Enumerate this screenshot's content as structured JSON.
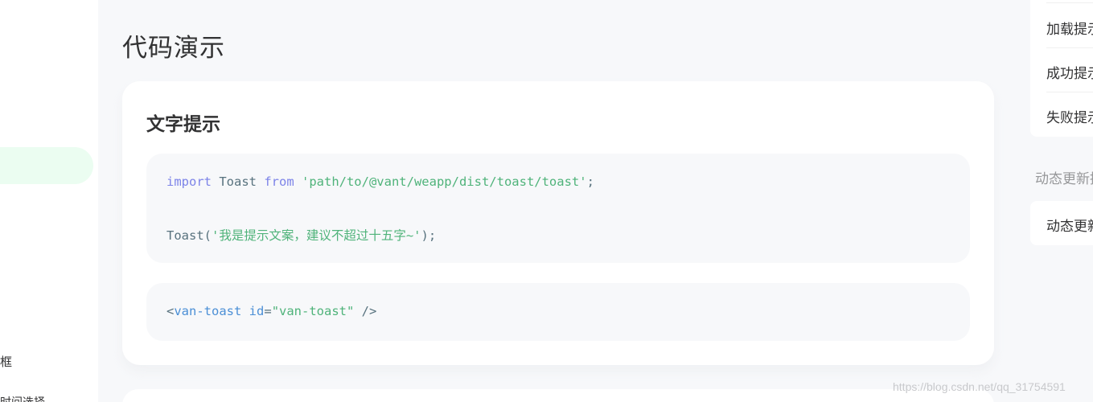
{
  "sidebar": {
    "items": [
      {
        "label": "框"
      },
      {
        "label": "时间选择"
      }
    ]
  },
  "main": {
    "page_title": "代码演示",
    "card": {
      "title": "文字提示",
      "code_js": {
        "line1": {
          "kw_import": "import",
          "ident": " Toast ",
          "kw_from": "from",
          "string": " 'path/to/@vant/weapp/dist/toast/toast'",
          "end": ";"
        },
        "line2": {
          "call": "Toast(",
          "string": "'我是提示文案，建议不超过十五字~'",
          "end": ");"
        }
      },
      "code_html": {
        "open": "<",
        "tag": "van-toast",
        "attr": " id",
        "eq": "=",
        "value": "\"van-toast\"",
        "close": " />"
      }
    }
  },
  "rightnav": {
    "items": [
      {
        "label": "加载提示"
      },
      {
        "label": "成功提示"
      },
      {
        "label": "失败提示"
      }
    ],
    "group_label": "动态更新提示",
    "group_items": [
      {
        "label": "动态更新提示"
      }
    ]
  },
  "watermark": "https://blog.csdn.net/qq_31754591"
}
